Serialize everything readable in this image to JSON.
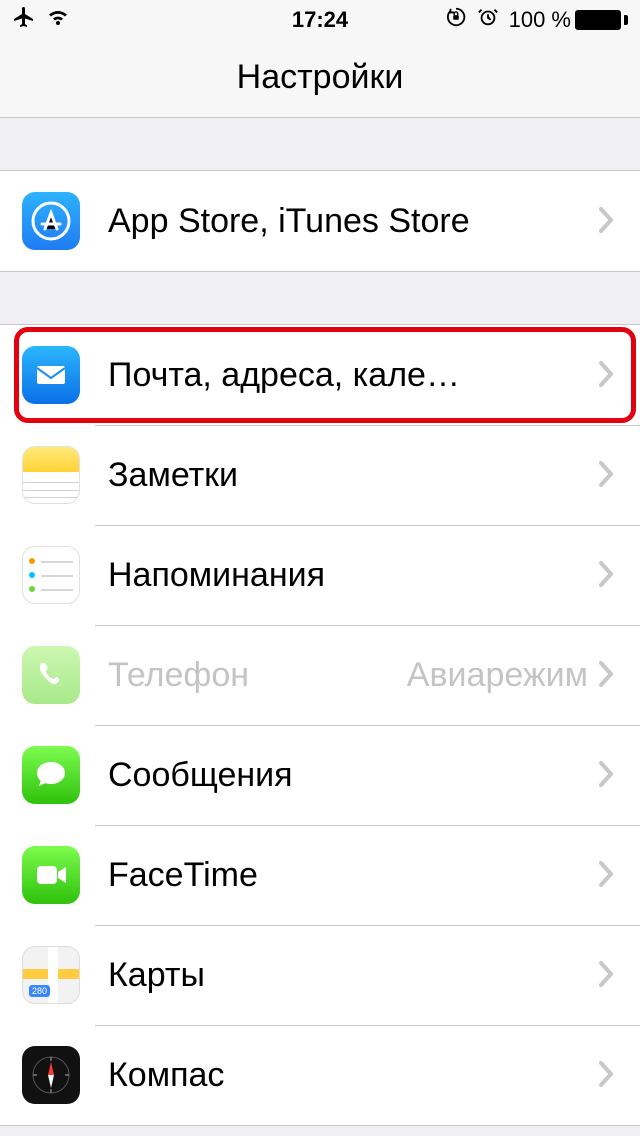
{
  "status": {
    "time": "17:24",
    "battery_text": "100 %"
  },
  "header": {
    "title": "Настройки"
  },
  "group1": {
    "items": [
      {
        "label": "App Store, iTunes Store"
      }
    ]
  },
  "group2": {
    "items": [
      {
        "label": "Почта, адреса, кале…"
      },
      {
        "label": "Заметки"
      },
      {
        "label": "Напоминания"
      },
      {
        "label": "Телефон",
        "detail": "Авиарежим"
      },
      {
        "label": "Сообщения"
      },
      {
        "label": "FaceTime"
      },
      {
        "label": "Карты"
      },
      {
        "label": "Компас"
      }
    ]
  },
  "maps_badge": "280"
}
